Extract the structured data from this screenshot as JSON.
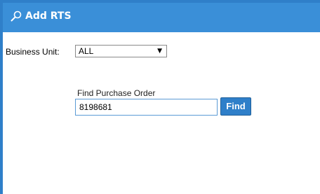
{
  "dialog": {
    "title": "Add RTS",
    "icon": "search-icon",
    "header_color": "#3a8fd8",
    "border_color": "#2f7fc9"
  },
  "business_unit": {
    "label": "Business Unit:",
    "selected": "ALL",
    "arrow": "▼"
  },
  "find": {
    "label": "Find Purchase Order",
    "value": "8198681",
    "button_label": "Find",
    "button_color": "#2f7fc9"
  }
}
